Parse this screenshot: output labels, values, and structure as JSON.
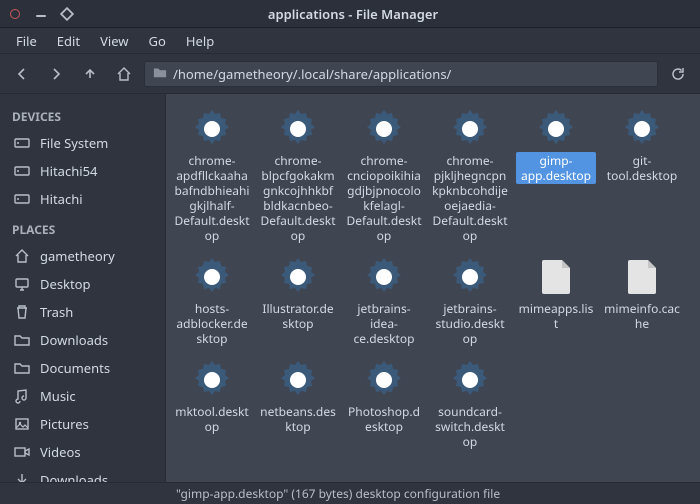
{
  "window": {
    "title": "applications - File Manager"
  },
  "menu": [
    "File",
    "Edit",
    "View",
    "Go",
    "Help"
  ],
  "location": {
    "path": "/home/gametheory/.local/share/applications/"
  },
  "sidebar": {
    "sections": [
      {
        "title": "DEVICES",
        "items": [
          {
            "icon": "drive-icon",
            "label": "File System"
          },
          {
            "icon": "drive-icon",
            "label": "Hitachi54"
          },
          {
            "icon": "drive-icon",
            "label": "Hitachi"
          }
        ]
      },
      {
        "title": "PLACES",
        "items": [
          {
            "icon": "home-icon",
            "label": "gametheory"
          },
          {
            "icon": "desktop-icon",
            "label": "Desktop"
          },
          {
            "icon": "trash-icon",
            "label": "Trash"
          },
          {
            "icon": "folder-icon",
            "label": "Downloads"
          },
          {
            "icon": "folder-icon",
            "label": "Documents"
          },
          {
            "icon": "music-icon",
            "label": "Music"
          },
          {
            "icon": "pictures-icon",
            "label": "Pictures"
          },
          {
            "icon": "videos-icon",
            "label": "Videos"
          },
          {
            "icon": "download-icon",
            "label": "Downloads"
          }
        ]
      }
    ]
  },
  "files": [
    {
      "type": "launcher",
      "label": "chrome-apdfllckaahabafndbhieahigkjlhalf-Default.desktop",
      "selected": false
    },
    {
      "type": "launcher",
      "label": "chrome-blpcfgokakmgnkcojhhkbfbldkacnbeo-Default.desktop",
      "selected": false
    },
    {
      "type": "launcher",
      "label": "chrome-cnciopoikihiagdjbjpnocolokfelagl-Default.desktop",
      "selected": false
    },
    {
      "type": "launcher",
      "label": "chrome-pjkljhegncpnkpknbcohdijeoejaedia-Default.desktop",
      "selected": false
    },
    {
      "type": "launcher",
      "label": "gimp-app.desktop",
      "selected": true
    },
    {
      "type": "launcher",
      "label": "git-tool.desktop",
      "selected": false
    },
    {
      "type": "launcher",
      "label": "hosts-adblocker.desktop",
      "selected": false
    },
    {
      "type": "launcher",
      "label": "Illustrator.desktop",
      "selected": false
    },
    {
      "type": "launcher",
      "label": "jetbrains-idea-ce.desktop",
      "selected": false
    },
    {
      "type": "launcher",
      "label": "jetbrains-studio.desktop",
      "selected": false
    },
    {
      "type": "file",
      "label": "mimeapps.list",
      "selected": false
    },
    {
      "type": "file",
      "label": "mimeinfo.cache",
      "selected": false
    },
    {
      "type": "launcher",
      "label": "mktool.desktop",
      "selected": false
    },
    {
      "type": "launcher",
      "label": "netbeans.desktop",
      "selected": false
    },
    {
      "type": "launcher",
      "label": "Photoshop.desktop",
      "selected": false
    },
    {
      "type": "launcher",
      "label": "soundcard-switch.desktop",
      "selected": false
    }
  ],
  "status": {
    "text": "\"gimp-app.desktop\" (167 bytes) desktop configuration file"
  },
  "colors": {
    "accent": "#5294e2",
    "panel": "#2f343f",
    "content": "#404552"
  }
}
